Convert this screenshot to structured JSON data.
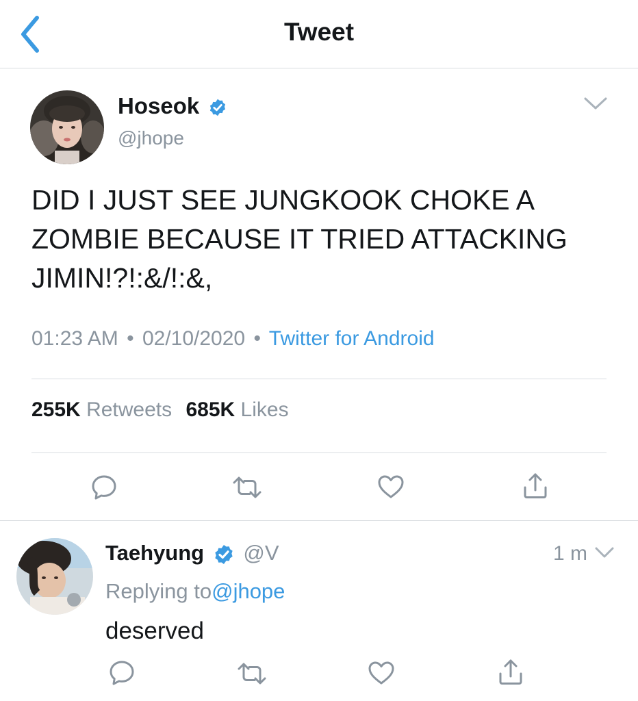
{
  "header": {
    "title": "Tweet",
    "back_icon": "chevron-left-icon"
  },
  "tweet": {
    "author_name": "Hoseok",
    "author_handle": "@jhope",
    "verified": true,
    "text": "DID I JUST SEE JUNGKOOK CHOKE A ZOMBIE BECAUSE IT TRIED ATTACKING JIMIN!?!:&/!:&,",
    "time": "01:23 AM",
    "date": "02/10/2020",
    "source": "Twitter for Android",
    "separator": "•",
    "retweets_count": "255K",
    "retweets_label": "Retweets",
    "likes_count": "685K",
    "likes_label": "Likes"
  },
  "reply": {
    "author_name": "Taehyung",
    "author_handle": "@V",
    "verified": true,
    "time_ago": "1 m",
    "replying_label": "Replying to",
    "replying_handle": "@jhope",
    "text": "deserved"
  },
  "colors": {
    "accent": "#3b9ae1",
    "text": "#14171a",
    "secondary": "#8a949e",
    "divider": "#d8dce0",
    "verified": "#3b9ae1"
  },
  "icons": {
    "reply": "comment-icon",
    "retweet": "retweet-icon",
    "like": "heart-icon",
    "share": "share-icon",
    "more": "chevron-down-icon"
  }
}
